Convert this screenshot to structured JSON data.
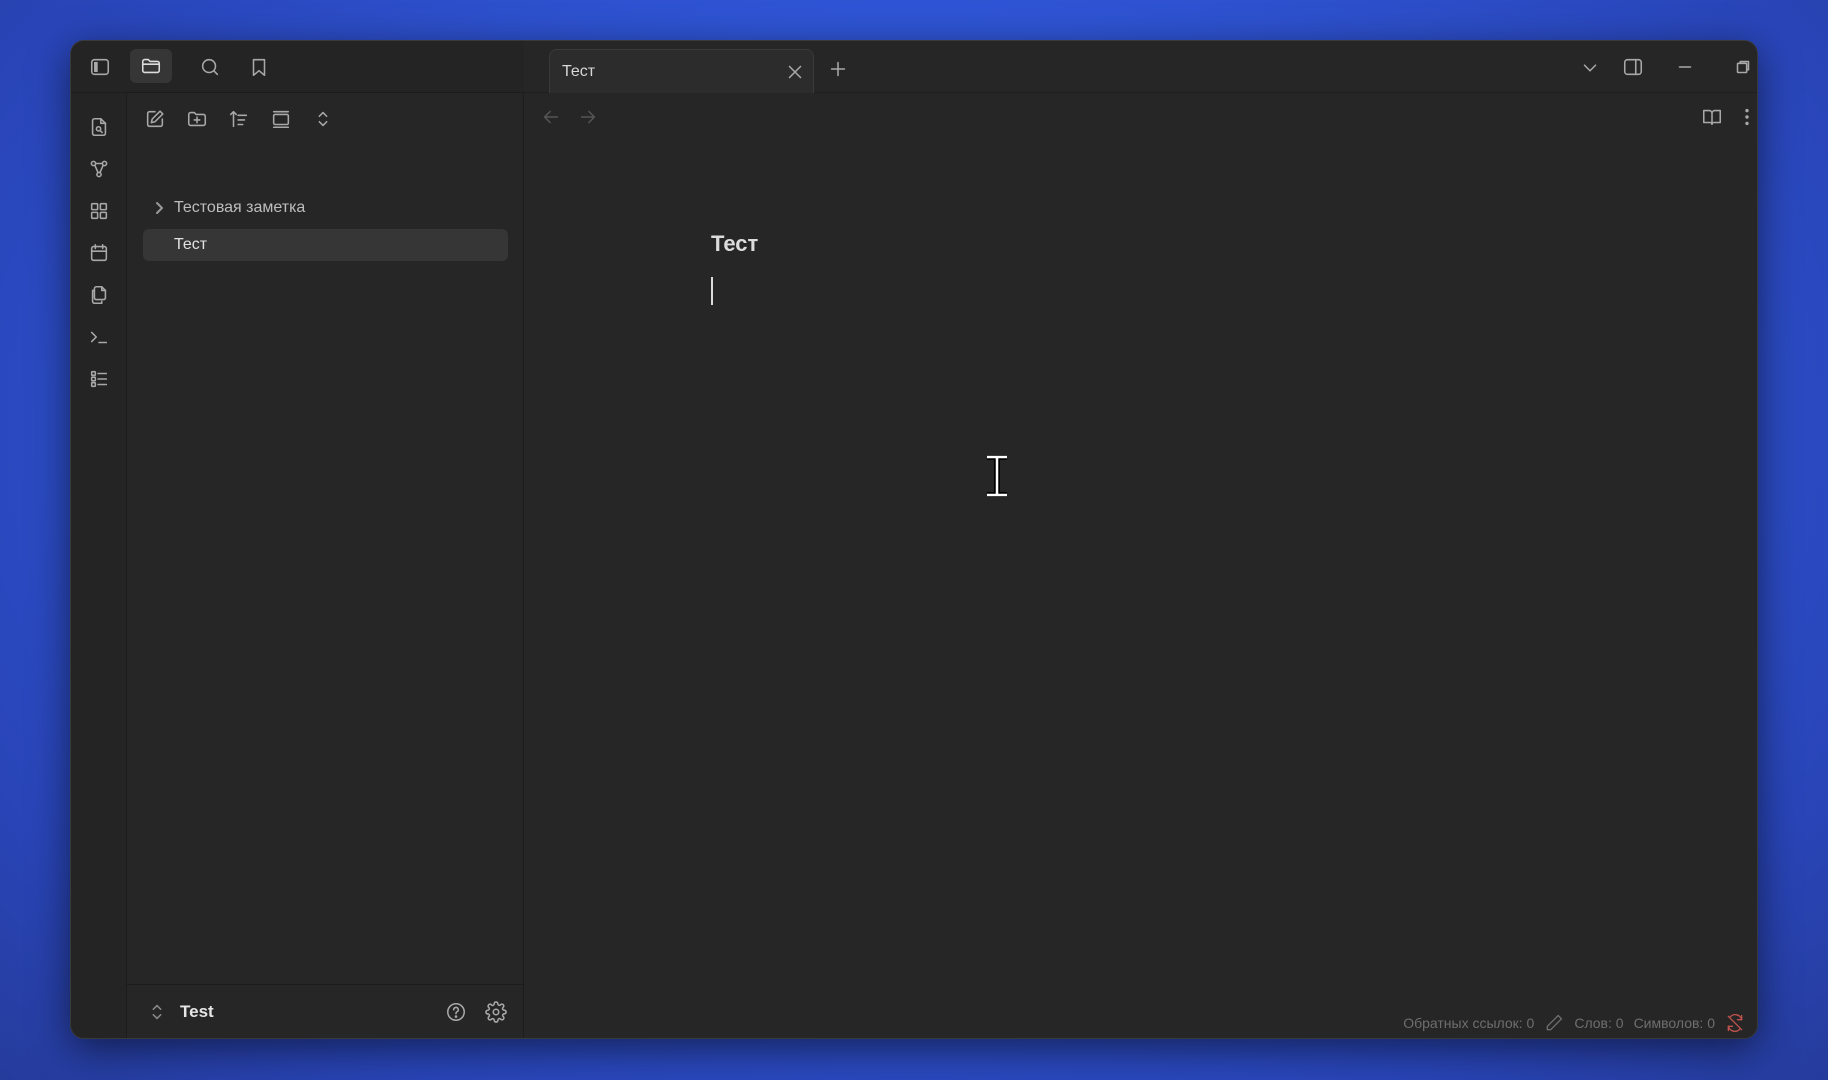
{
  "tab": {
    "title": "Тест"
  },
  "file_tree": [
    {
      "label": "Тестовая заметка",
      "type": "folder",
      "expanded": false
    },
    {
      "label": "Тест",
      "type": "file",
      "selected": true
    }
  ],
  "vault": {
    "name": "Test"
  },
  "editor": {
    "title": "Тест",
    "body": ""
  },
  "status_bar": {
    "backlinks": "Обратных ссылок: 0",
    "words": "Слов: 0",
    "characters": "Символов: 0"
  },
  "colors": {
    "background": "#2f55d6",
    "panel": "#262626",
    "sync_error": "#c0524f"
  }
}
